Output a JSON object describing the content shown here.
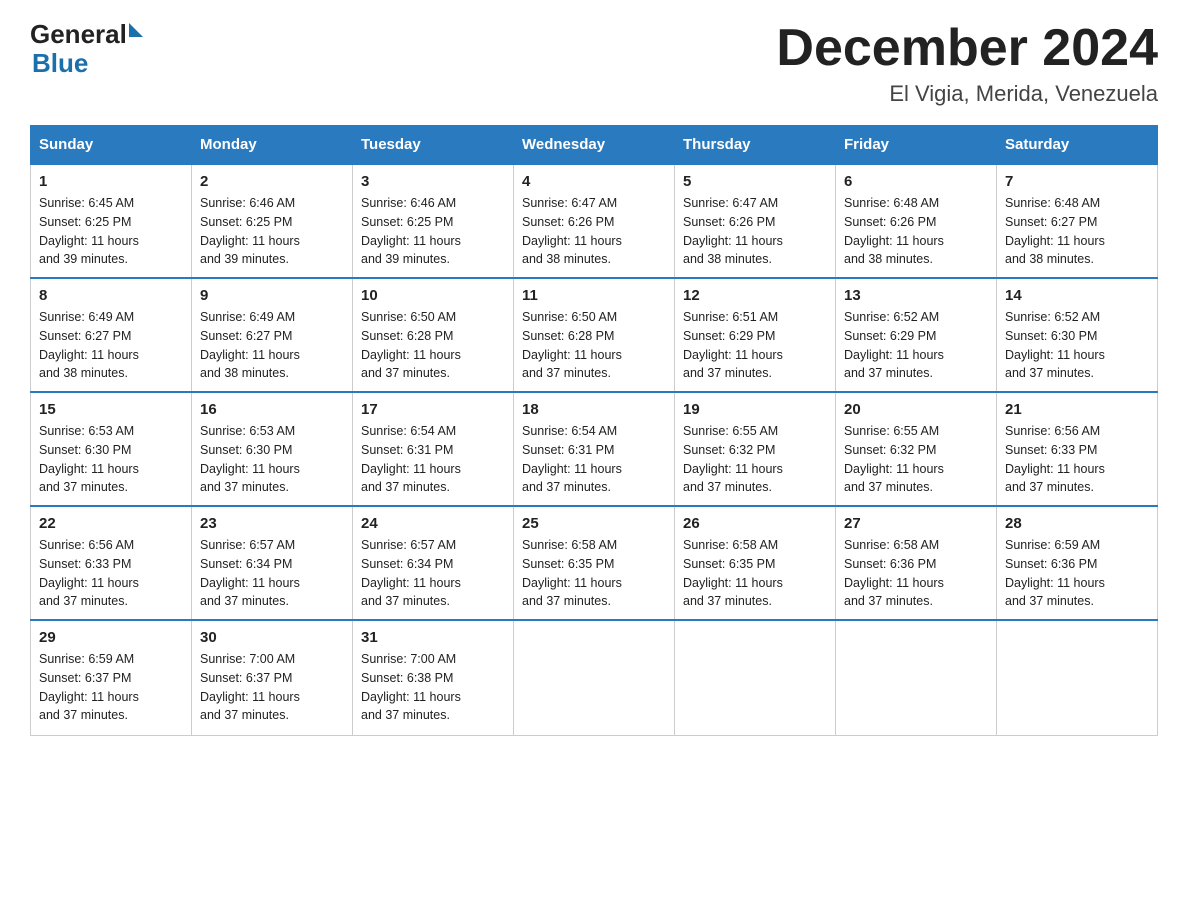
{
  "header": {
    "logo_general": "General",
    "logo_blue": "Blue",
    "month_title": "December 2024",
    "location": "El Vigia, Merida, Venezuela"
  },
  "days_of_week": [
    "Sunday",
    "Monday",
    "Tuesday",
    "Wednesday",
    "Thursday",
    "Friday",
    "Saturday"
  ],
  "weeks": [
    [
      {
        "day": "1",
        "sunrise": "6:45 AM",
        "sunset": "6:25 PM",
        "daylight": "11 hours and 39 minutes."
      },
      {
        "day": "2",
        "sunrise": "6:46 AM",
        "sunset": "6:25 PM",
        "daylight": "11 hours and 39 minutes."
      },
      {
        "day": "3",
        "sunrise": "6:46 AM",
        "sunset": "6:25 PM",
        "daylight": "11 hours and 39 minutes."
      },
      {
        "day": "4",
        "sunrise": "6:47 AM",
        "sunset": "6:26 PM",
        "daylight": "11 hours and 38 minutes."
      },
      {
        "day": "5",
        "sunrise": "6:47 AM",
        "sunset": "6:26 PM",
        "daylight": "11 hours and 38 minutes."
      },
      {
        "day": "6",
        "sunrise": "6:48 AM",
        "sunset": "6:26 PM",
        "daylight": "11 hours and 38 minutes."
      },
      {
        "day": "7",
        "sunrise": "6:48 AM",
        "sunset": "6:27 PM",
        "daylight": "11 hours and 38 minutes."
      }
    ],
    [
      {
        "day": "8",
        "sunrise": "6:49 AM",
        "sunset": "6:27 PM",
        "daylight": "11 hours and 38 minutes."
      },
      {
        "day": "9",
        "sunrise": "6:49 AM",
        "sunset": "6:27 PM",
        "daylight": "11 hours and 38 minutes."
      },
      {
        "day": "10",
        "sunrise": "6:50 AM",
        "sunset": "6:28 PM",
        "daylight": "11 hours and 37 minutes."
      },
      {
        "day": "11",
        "sunrise": "6:50 AM",
        "sunset": "6:28 PM",
        "daylight": "11 hours and 37 minutes."
      },
      {
        "day": "12",
        "sunrise": "6:51 AM",
        "sunset": "6:29 PM",
        "daylight": "11 hours and 37 minutes."
      },
      {
        "day": "13",
        "sunrise": "6:52 AM",
        "sunset": "6:29 PM",
        "daylight": "11 hours and 37 minutes."
      },
      {
        "day": "14",
        "sunrise": "6:52 AM",
        "sunset": "6:30 PM",
        "daylight": "11 hours and 37 minutes."
      }
    ],
    [
      {
        "day": "15",
        "sunrise": "6:53 AM",
        "sunset": "6:30 PM",
        "daylight": "11 hours and 37 minutes."
      },
      {
        "day": "16",
        "sunrise": "6:53 AM",
        "sunset": "6:30 PM",
        "daylight": "11 hours and 37 minutes."
      },
      {
        "day": "17",
        "sunrise": "6:54 AM",
        "sunset": "6:31 PM",
        "daylight": "11 hours and 37 minutes."
      },
      {
        "day": "18",
        "sunrise": "6:54 AM",
        "sunset": "6:31 PM",
        "daylight": "11 hours and 37 minutes."
      },
      {
        "day": "19",
        "sunrise": "6:55 AM",
        "sunset": "6:32 PM",
        "daylight": "11 hours and 37 minutes."
      },
      {
        "day": "20",
        "sunrise": "6:55 AM",
        "sunset": "6:32 PM",
        "daylight": "11 hours and 37 minutes."
      },
      {
        "day": "21",
        "sunrise": "6:56 AM",
        "sunset": "6:33 PM",
        "daylight": "11 hours and 37 minutes."
      }
    ],
    [
      {
        "day": "22",
        "sunrise": "6:56 AM",
        "sunset": "6:33 PM",
        "daylight": "11 hours and 37 minutes."
      },
      {
        "day": "23",
        "sunrise": "6:57 AM",
        "sunset": "6:34 PM",
        "daylight": "11 hours and 37 minutes."
      },
      {
        "day": "24",
        "sunrise": "6:57 AM",
        "sunset": "6:34 PM",
        "daylight": "11 hours and 37 minutes."
      },
      {
        "day": "25",
        "sunrise": "6:58 AM",
        "sunset": "6:35 PM",
        "daylight": "11 hours and 37 minutes."
      },
      {
        "day": "26",
        "sunrise": "6:58 AM",
        "sunset": "6:35 PM",
        "daylight": "11 hours and 37 minutes."
      },
      {
        "day": "27",
        "sunrise": "6:58 AM",
        "sunset": "6:36 PM",
        "daylight": "11 hours and 37 minutes."
      },
      {
        "day": "28",
        "sunrise": "6:59 AM",
        "sunset": "6:36 PM",
        "daylight": "11 hours and 37 minutes."
      }
    ],
    [
      {
        "day": "29",
        "sunrise": "6:59 AM",
        "sunset": "6:37 PM",
        "daylight": "11 hours and 37 minutes."
      },
      {
        "day": "30",
        "sunrise": "7:00 AM",
        "sunset": "6:37 PM",
        "daylight": "11 hours and 37 minutes."
      },
      {
        "day": "31",
        "sunrise": "7:00 AM",
        "sunset": "6:38 PM",
        "daylight": "11 hours and 37 minutes."
      },
      null,
      null,
      null,
      null
    ]
  ],
  "labels": {
    "sunrise_prefix": "Sunrise: ",
    "sunset_prefix": "Sunset: ",
    "daylight_prefix": "Daylight: "
  }
}
